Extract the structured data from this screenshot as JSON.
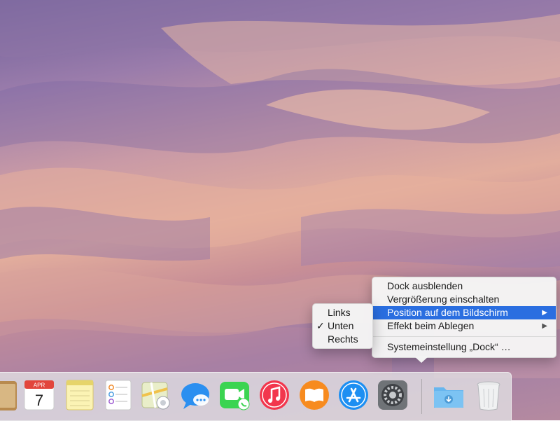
{
  "desktop": {
    "wallpaper": "desert-dunes-wallpaper"
  },
  "dock_menu": {
    "items": [
      {
        "label": "Dock ausblenden"
      },
      {
        "label": "Vergrößerung einschalten"
      },
      {
        "label": "Position auf dem Bildschirm",
        "submenu_arrow": "▶"
      },
      {
        "label": "Effekt beim Ablegen",
        "submenu_arrow": "▶"
      },
      {
        "label": "Systemeinstellung „Dock“ …"
      }
    ],
    "highlight_color": "#2a6ee0"
  },
  "position_submenu": {
    "items": [
      {
        "label": "Links"
      },
      {
        "label": "Unten",
        "checkmark": "✓"
      },
      {
        "label": "Rechts"
      }
    ]
  },
  "dock": {
    "calendar": {
      "month": "APR",
      "day": "7"
    },
    "icons": [
      "contacts-icon",
      "calendar-icon",
      "notes-icon",
      "reminders-icon",
      "maps-icon",
      "messages-icon",
      "facetime-icon",
      "itunes-icon",
      "ibooks-icon",
      "app-store-icon",
      "system-preferences-icon",
      "downloads-folder-icon",
      "trash-icon"
    ]
  }
}
